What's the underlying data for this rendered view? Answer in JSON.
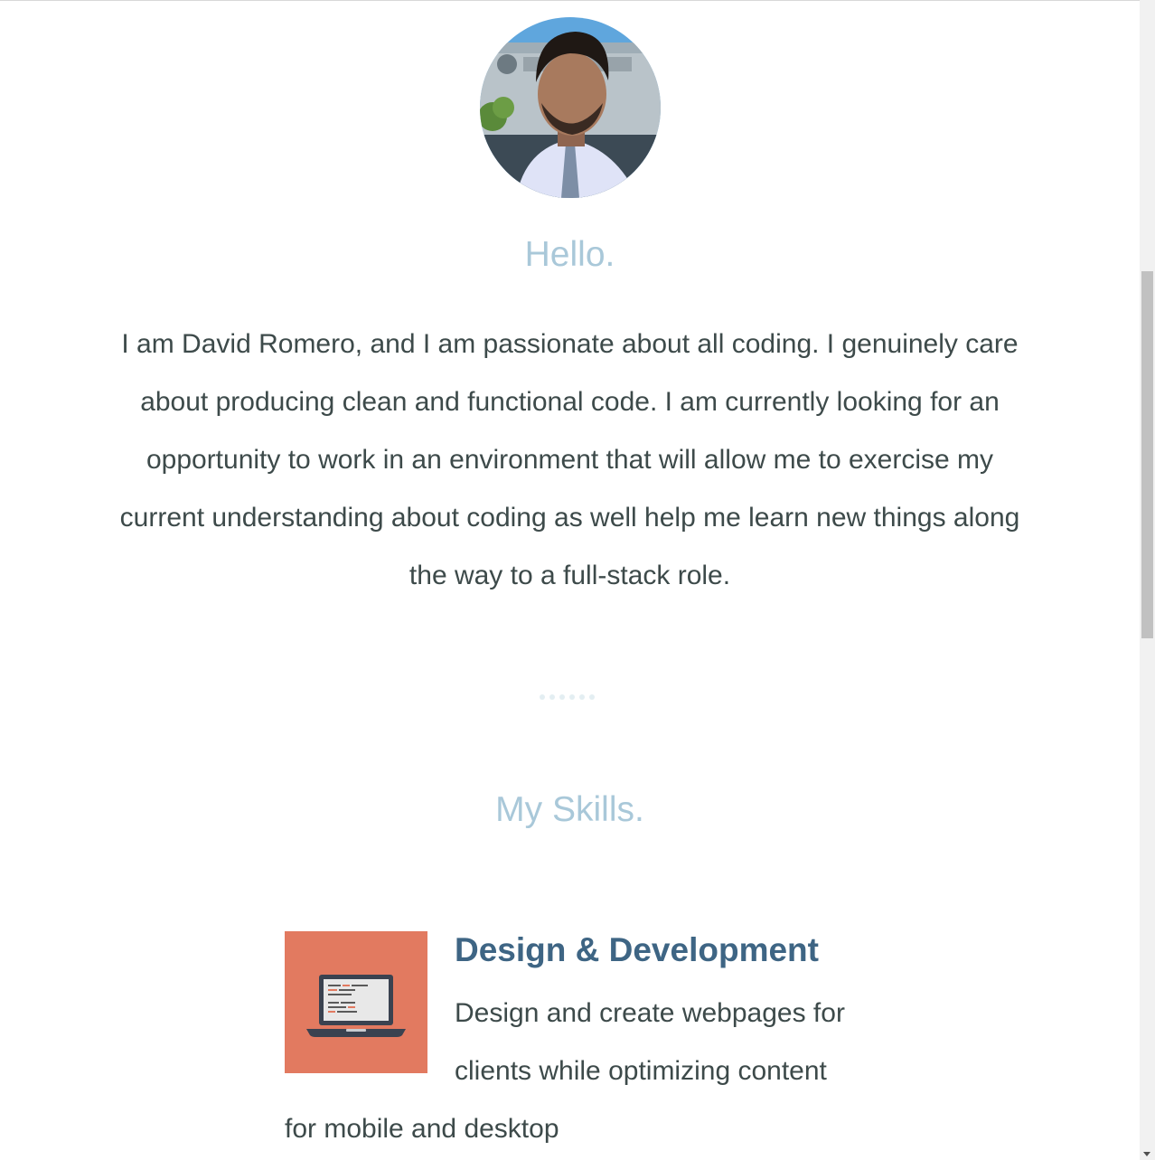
{
  "profile": {
    "avatar_alt": "David Romero portrait",
    "greeting": "Hello.",
    "intro": "I am David Romero, and I am passionate about all coding. I genuinely care about producing clean and functional code. I am currently looking for an opportunity to work in an environment that will allow me to exercise my current understanding about coding as well help me learn new things along the way to a full-stack role."
  },
  "skills": {
    "heading": "My Skills.",
    "items": [
      {
        "title": "Design & Development",
        "description": "Design and create webpages for clients while optimizing content for mobile and desktop",
        "icon": "laptop-code-icon",
        "icon_bg": "#e27a60"
      }
    ]
  },
  "colors": {
    "heading": "#a9c8d9",
    "body_text": "#3d4a4a",
    "skill_title": "#3e6584"
  }
}
